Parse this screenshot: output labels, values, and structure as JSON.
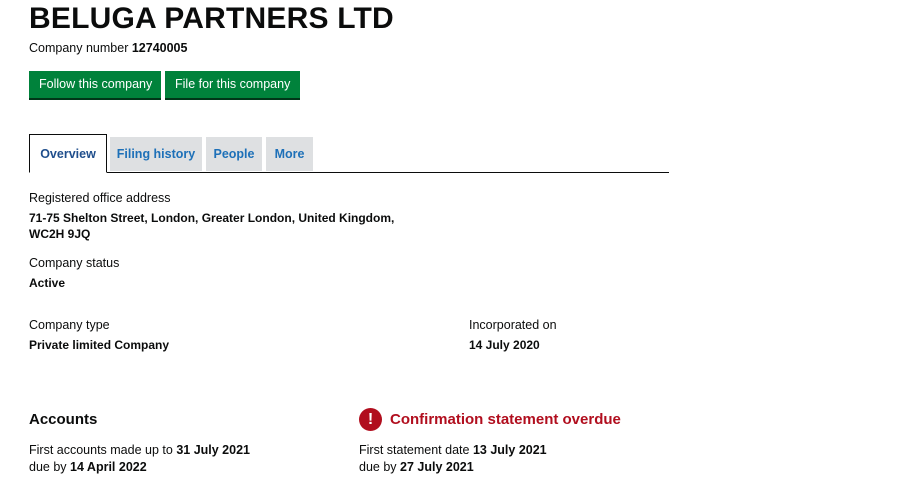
{
  "company": {
    "name": "BELUGA PARTNERS LTD",
    "number_label": "Company number",
    "number": "12740005"
  },
  "actions": {
    "follow_label": "Follow this company",
    "file_label": "File for this company"
  },
  "tabs": [
    {
      "label": "Overview",
      "active": true
    },
    {
      "label": "Filing history",
      "active": false
    },
    {
      "label": "People",
      "active": false
    },
    {
      "label": "More",
      "active": false
    }
  ],
  "overview": {
    "registered_office_label": "Registered office address",
    "registered_office_line1": "71-75 Shelton Street, London, Greater London, United Kingdom,",
    "registered_office_line2": "WC2H 9JQ",
    "status_label": "Company status",
    "status_value": "Active",
    "type_label": "Company type",
    "type_value": "Private limited Company",
    "incorporated_label": "Incorporated on",
    "incorporated_value": "14 July 2020"
  },
  "accounts": {
    "heading": "Accounts",
    "first_made_up_prefix": "First accounts made up to",
    "first_made_up_date": "31 July 2021",
    "due_prefix": "due by",
    "due_date": "14 April 2022"
  },
  "confirmation": {
    "icon_symbol": "!",
    "icon_color": "#b10e1e",
    "heading": "Confirmation statement overdue",
    "first_statement_prefix": "First statement date",
    "first_statement_date": "13 July 2021",
    "due_prefix": "due by",
    "due_date": "27 July 2021"
  },
  "colors": {
    "button_green": "#00823b",
    "tab_link_blue": "#1d70b8",
    "overdue_red": "#b10e1e"
  }
}
